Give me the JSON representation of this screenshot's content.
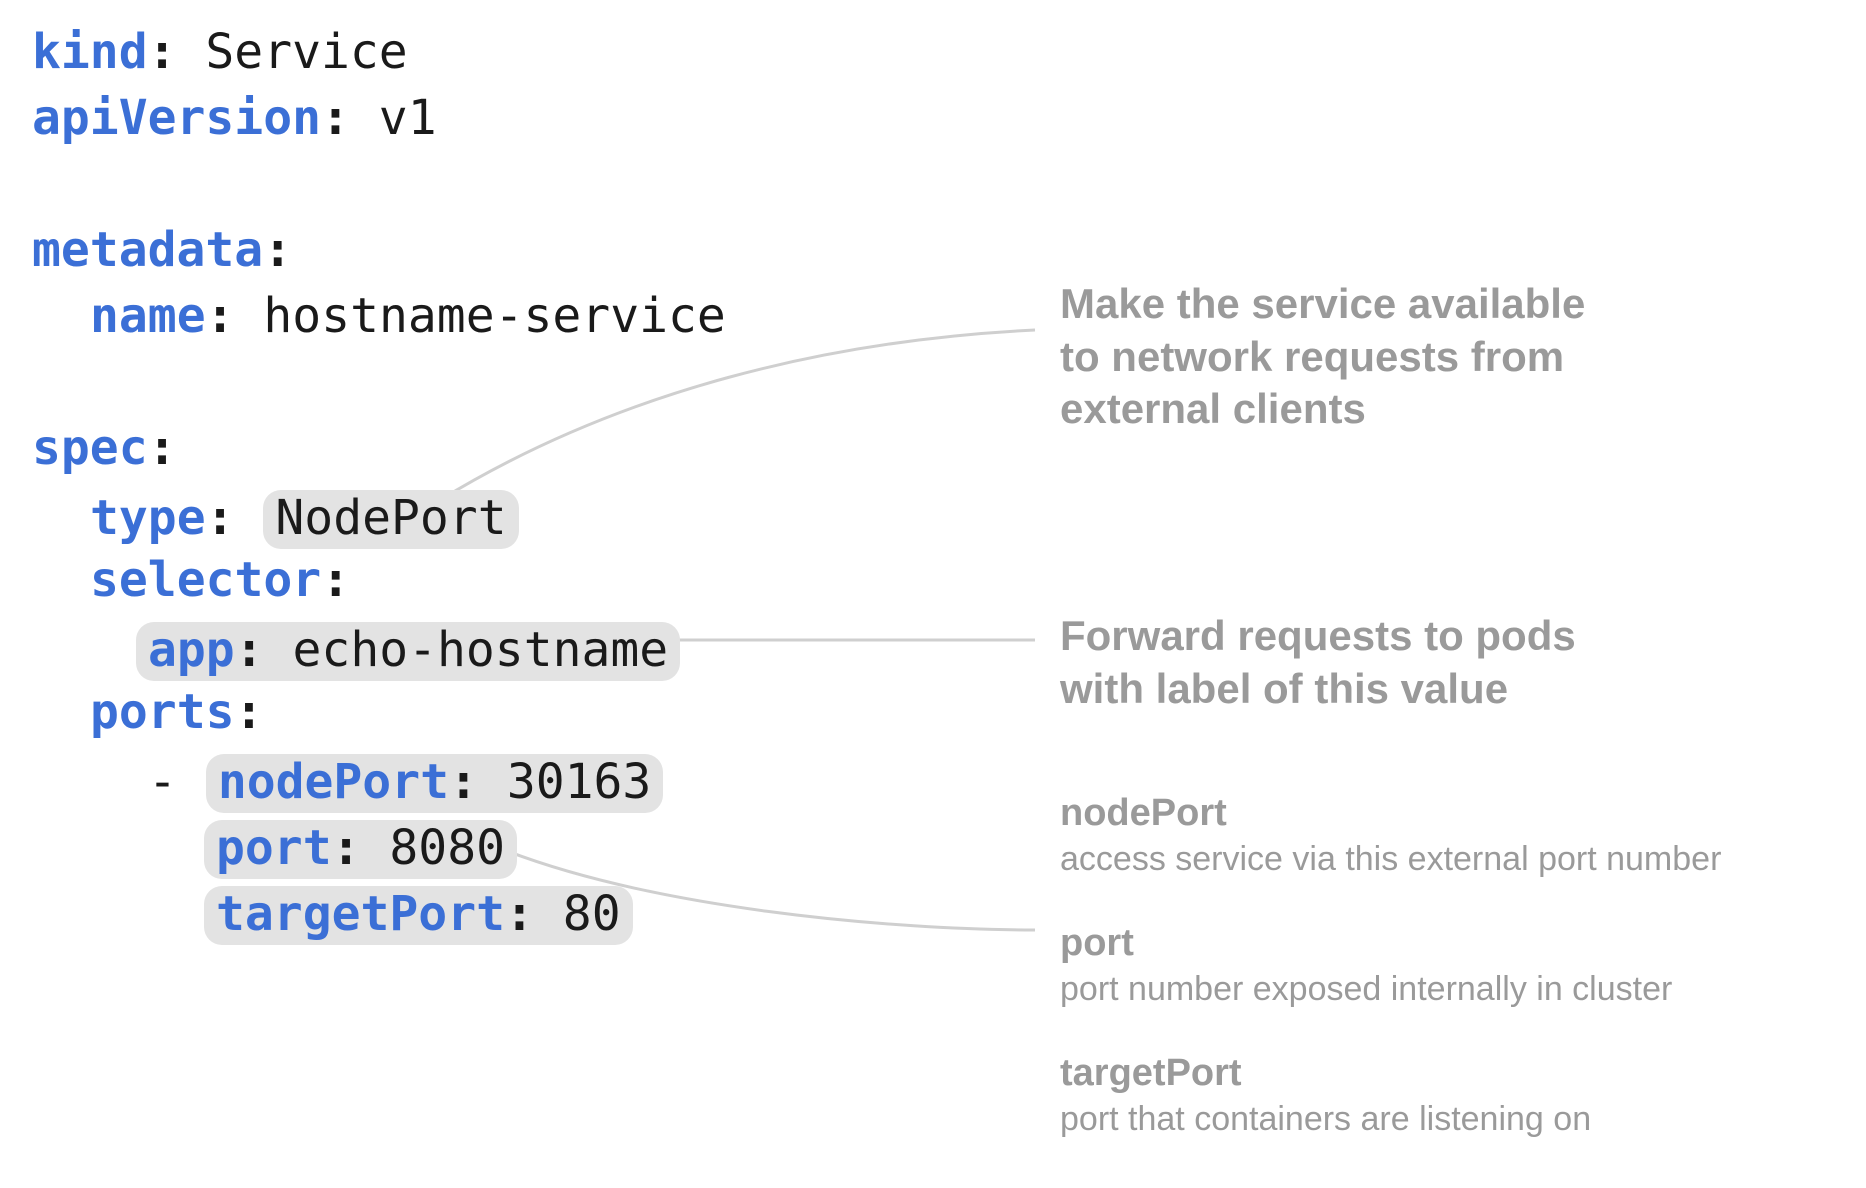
{
  "yaml": {
    "kind_key": "kind",
    "kind_val": "Service",
    "apiVer_key": "apiVersion",
    "apiVer_val": "v1",
    "metadata_key": "metadata",
    "name_key": "name",
    "name_val": "hostname-service",
    "spec_key": "spec",
    "type_key": "type",
    "type_val": "NodePort",
    "selector_key": "selector",
    "app_key": "app",
    "app_val": "echo-hostname",
    "ports_key": "ports",
    "nodePort_key": "nodePort",
    "nodePort_val": "30163",
    "port_key": "port",
    "port_val": "8080",
    "targetPort_key": "targetPort",
    "targetPort_val": "80"
  },
  "annotations": {
    "type_desc_l1": "Make the service available",
    "type_desc_l2": "to network requests from",
    "type_desc_l3": "external clients",
    "selector_desc_l1": "Forward requests to pods",
    "selector_desc_l2": "with label of this value",
    "np_term": "nodePort",
    "np_desc": "access service via this external port number",
    "p_term": "port",
    "p_desc": "port number exposed internally in cluster",
    "tp_term": "targetPort",
    "tp_desc": "port that containers are listening on"
  }
}
